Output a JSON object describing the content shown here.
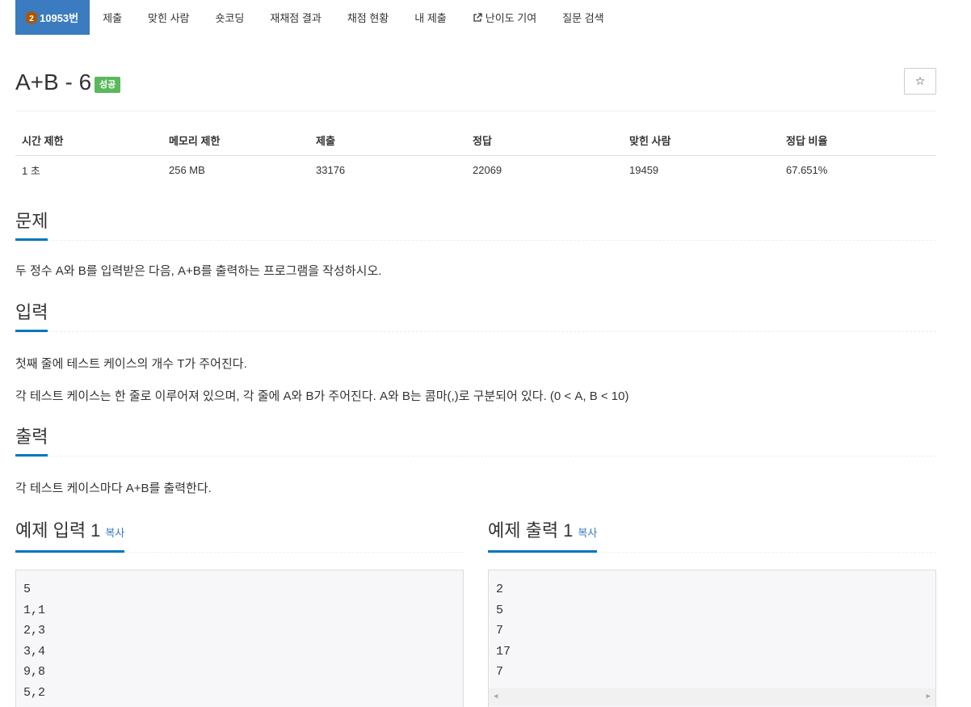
{
  "nav": {
    "problem_id": "10953번",
    "items": [
      "제출",
      "맞힌 사람",
      "숏코딩",
      "재채점 결과",
      "채점 현황",
      "내 제출",
      "난이도 기여",
      "질문 검색"
    ]
  },
  "title": "A+B - 6",
  "status_badge": "성공",
  "star_label": "☆",
  "info_table": {
    "headers": [
      "시간 제한",
      "메모리 제한",
      "제출",
      "정답",
      "맞힌 사람",
      "정답 비율"
    ],
    "values": [
      "1 초",
      "256 MB",
      "33176",
      "22069",
      "19459",
      "67.651%"
    ]
  },
  "sections": {
    "problem": {
      "title": "문제",
      "text": "두 정수 A와 B를 입력받은 다음, A+B를 출력하는 프로그램을 작성하시오."
    },
    "input": {
      "title": "입력",
      "text1": "첫째 줄에 테스트 케이스의 개수 T가 주어진다.",
      "text2": "각 테스트 케이스는 한 줄로 이루어져 있으며, 각 줄에 A와 B가 주어진다. A와 B는 콤마(,)로 구분되어 있다. (0 < A, B < 10)"
    },
    "output": {
      "title": "출력",
      "text": "각 테스트 케이스마다 A+B를 출력한다."
    }
  },
  "sample_input": {
    "title": "예제 입력 1",
    "copy": "복사",
    "lines": [
      "5",
      "1,1",
      "2,3",
      "3,4",
      "9,8",
      "5,2"
    ]
  },
  "sample_output": {
    "title": "예제 출력 1",
    "copy": "복사",
    "lines": [
      "2",
      "5",
      "7",
      "17",
      "7"
    ]
  },
  "colors": {
    "nav_active": "#3b7bbf",
    "success": "#5cb85c",
    "underline": "#0076c0",
    "tier_bronze": "#ad5600"
  },
  "icons": {
    "tier": "tier-bronze-icon",
    "external": "external-link-icon",
    "star": "star-icon"
  }
}
